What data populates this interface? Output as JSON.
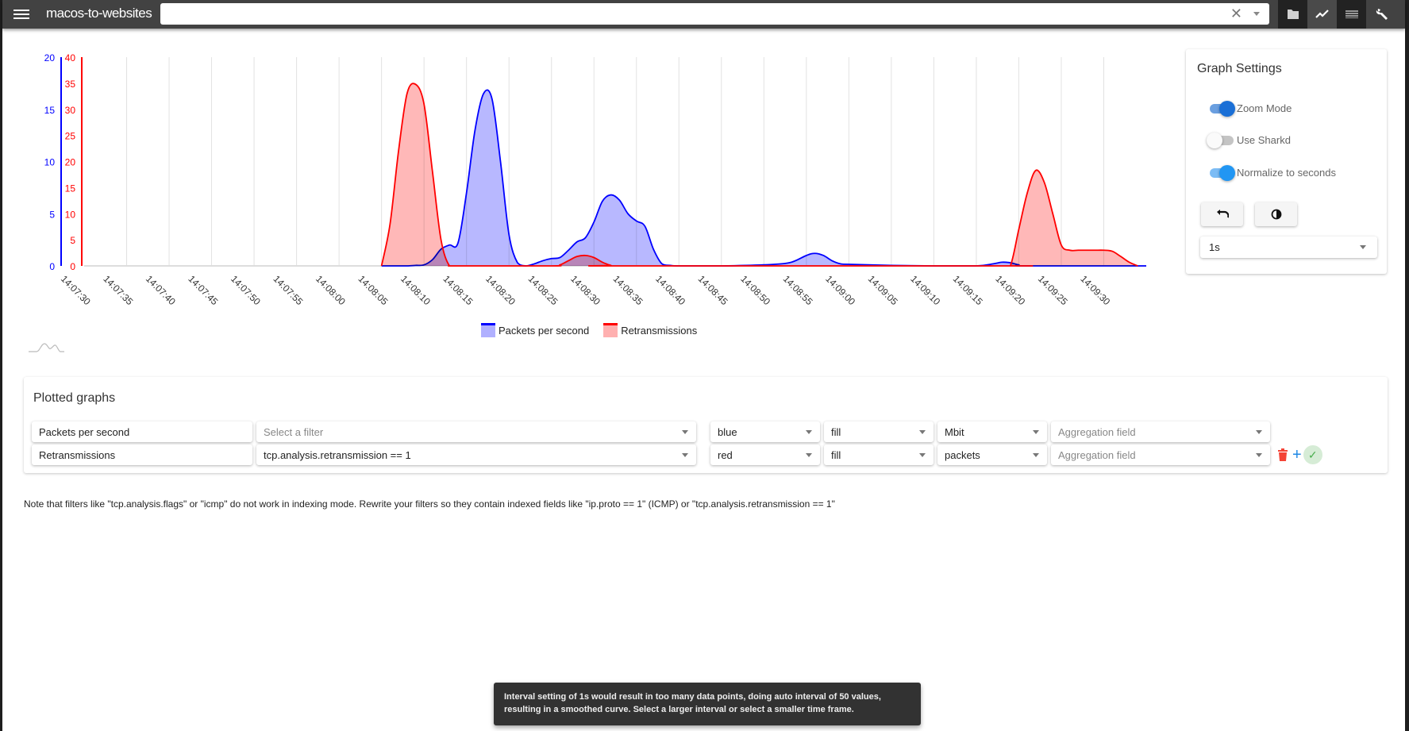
{
  "header": {
    "title": "macos-to-websites",
    "search_value": "",
    "search_placeholder": "",
    "tool_buttons": [
      {
        "name": "folder-button",
        "icon": "folder-icon"
      },
      {
        "name": "graph-button",
        "icon": "chart-line-icon",
        "active": true
      },
      {
        "name": "list-button",
        "icon": "list-icon"
      },
      {
        "name": "settings-button",
        "icon": "wrench-icon"
      }
    ]
  },
  "chart_data": {
    "type": "area",
    "title": "",
    "x": [
      "14:07:30",
      "14:07:35",
      "14:07:40",
      "14:07:45",
      "14:07:50",
      "14:07:55",
      "14:08:00",
      "14:08:05",
      "14:08:10",
      "14:08:15",
      "14:08:20",
      "14:08:25",
      "14:08:30",
      "14:08:35",
      "14:08:40",
      "14:08:45",
      "14:08:50",
      "14:08:55",
      "14:09:00",
      "14:09:05",
      "14:09:10",
      "14:09:15",
      "14:09:20",
      "14:09:25",
      "14:09:30"
    ],
    "xlabel": "",
    "y_axes": [
      {
        "name": "left-blue",
        "color": "#0000ff",
        "range": [
          0,
          20
        ],
        "ticks": [
          0,
          5,
          10,
          15,
          20
        ]
      },
      {
        "name": "left-red",
        "color": "#ff0000",
        "range": [
          0,
          40
        ],
        "ticks": [
          0,
          5,
          10,
          15,
          20,
          25,
          30,
          35,
          40
        ]
      }
    ],
    "grid": true,
    "legend_position": "bottom-center",
    "series": [
      {
        "name": "Packets per second",
        "color": "#0000ff",
        "fill": "#b0b0ff",
        "axis": "left-blue",
        "points": [
          [
            35,
            0
          ],
          [
            36,
            0
          ],
          [
            37,
            0
          ],
          [
            38,
            0
          ],
          [
            39,
            0.05
          ],
          [
            40,
            0.1
          ],
          [
            41,
            0.6
          ],
          [
            42,
            1.6
          ],
          [
            43,
            2.0
          ],
          [
            44,
            2.2
          ],
          [
            45,
            7
          ],
          [
            46,
            13
          ],
          [
            47,
            16.5
          ],
          [
            48,
            16.0
          ],
          [
            49,
            10
          ],
          [
            50,
            3
          ],
          [
            51,
            0.3
          ],
          [
            52,
            0
          ],
          [
            53,
            0.2
          ],
          [
            54,
            0.5
          ],
          [
            55,
            0.7
          ],
          [
            56,
            0.8
          ],
          [
            57,
            1.5
          ],
          [
            58,
            2.3
          ],
          [
            59,
            2.7
          ],
          [
            60,
            4.2
          ],
          [
            61,
            6.2
          ],
          [
            62,
            6.8
          ],
          [
            63,
            6.3
          ],
          [
            64,
            5.0
          ],
          [
            65,
            4.3
          ],
          [
            66,
            3.8
          ],
          [
            67,
            1.6
          ],
          [
            68,
            0.2
          ],
          [
            69,
            0.05
          ],
          [
            70,
            0
          ],
          [
            75,
            0
          ],
          [
            80,
            0.1
          ],
          [
            83,
            0.3
          ],
          [
            85,
            1.0
          ],
          [
            86,
            1.2
          ],
          [
            87,
            1.0
          ],
          [
            88,
            0.5
          ],
          [
            89,
            0.2
          ],
          [
            90,
            0.15
          ],
          [
            95,
            0.05
          ],
          [
            100,
            0
          ],
          [
            105,
            0
          ],
          [
            107,
            0.2
          ],
          [
            108,
            0.35
          ],
          [
            109,
            0.3
          ],
          [
            110,
            0.1
          ],
          [
            111,
            0
          ],
          [
            125,
            0
          ]
        ]
      },
      {
        "name": "Retransmissions",
        "color": "#ff0000",
        "fill": "#ffb0b0",
        "axis": "left-red",
        "points": [
          [
            35,
            0
          ],
          [
            36,
            8
          ],
          [
            37,
            22
          ],
          [
            38,
            33
          ],
          [
            39,
            34.8
          ],
          [
            40,
            31
          ],
          [
            41,
            18
          ],
          [
            42,
            5
          ],
          [
            43,
            0
          ],
          [
            44,
            0
          ],
          [
            55,
            0
          ],
          [
            56,
            0.2
          ],
          [
            57,
            1.0
          ],
          [
            58,
            1.8
          ],
          [
            59,
            2.0
          ],
          [
            60,
            1.6
          ],
          [
            61,
            0.7
          ],
          [
            62,
            0.1
          ],
          [
            63,
            0
          ],
          [
            108,
            0
          ],
          [
            109,
            0
          ],
          [
            110,
            7
          ],
          [
            111,
            14
          ],
          [
            112,
            18.3
          ],
          [
            113,
            16
          ],
          [
            114,
            10
          ],
          [
            115,
            4
          ],
          [
            116,
            3
          ],
          [
            117,
            3
          ],
          [
            118,
            3
          ],
          [
            119,
            3
          ],
          [
            120,
            3
          ],
          [
            121,
            2.8
          ],
          [
            122,
            1.8
          ],
          [
            123,
            0.7
          ],
          [
            124,
            0
          ]
        ]
      }
    ],
    "x_range_seconds": [
      0,
      125
    ]
  },
  "legend": [
    {
      "label": "Packets per second",
      "color": "#0000ff",
      "fill": "#b0b0ff"
    },
    {
      "label": "Retransmissions",
      "color": "#ff0000",
      "fill": "#ffb0b0"
    }
  ],
  "settings": {
    "title": "Graph Settings",
    "toggles": [
      {
        "label": "Zoom Mode",
        "on": true
      },
      {
        "label": "Use Sharkd",
        "on": false
      },
      {
        "label": "Normalize to seconds",
        "on": true
      }
    ],
    "undo_icon": "undo-icon",
    "contrast_icon": "contrast-icon",
    "interval": "1s"
  },
  "plotted": {
    "title": "Plotted graphs",
    "rows": [
      {
        "name": "Packets per second",
        "filter": "",
        "filter_placeholder": "Select a filter",
        "color": "blue",
        "style": "fill",
        "unit": "Mbit",
        "aggregation": "",
        "aggregation_placeholder": "Aggregation field"
      },
      {
        "name": "Retransmissions",
        "filter": "tcp.analysis.retransmission == 1",
        "filter_placeholder": "Select a filter",
        "color": "red",
        "style": "fill",
        "unit": "packets",
        "aggregation": "",
        "aggregation_placeholder": "Aggregation field"
      }
    ],
    "actions": {
      "delete": "trash-icon",
      "add": "+",
      "confirm": "✓"
    }
  },
  "note": "Note that filters like \"tcp.analysis.flags\" or \"icmp\" do not work in indexing mode. Rewrite your filters so they contain indexed fields like \"ip.proto == 1\" (ICMP) or \"tcp.analysis.retransmission == 1\"",
  "snackbar": "Interval setting of 1s would result in too many data points, doing auto interval of 50 values, resulting in a smoothed curve. Select a larger interval or select a smaller time frame."
}
